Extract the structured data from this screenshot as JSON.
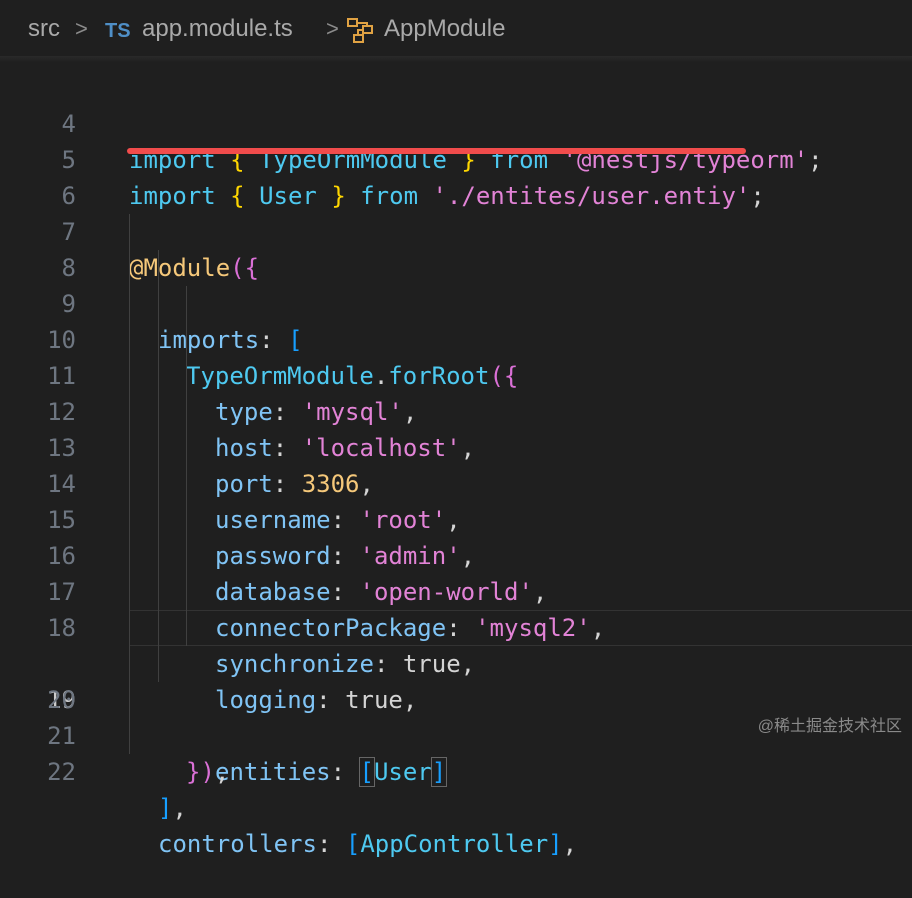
{
  "breadcrumb": {
    "folder": "src",
    "sep1": ">",
    "lang_badge": "TS",
    "file": "app.module.ts",
    "sep2": ">",
    "symbol": "AppModule"
  },
  "editor": {
    "active_line": "19",
    "lines": [
      {
        "num": "4"
      },
      {
        "num": "5"
      },
      {
        "num": "6"
      },
      {
        "num": "7"
      },
      {
        "num": "8"
      },
      {
        "num": "9"
      },
      {
        "num": "10"
      },
      {
        "num": "11"
      },
      {
        "num": "12"
      },
      {
        "num": "13"
      },
      {
        "num": "14"
      },
      {
        "num": "15"
      },
      {
        "num": "16"
      },
      {
        "num": "17"
      },
      {
        "num": "18"
      },
      {
        "num": "19"
      },
      {
        "num": "20"
      },
      {
        "num": "21"
      },
      {
        "num": "22"
      }
    ],
    "tokens": {
      "l4": [
        "import",
        "{",
        "TypeOrmModule",
        "}",
        "from",
        "'@nestjs/typeorm'",
        ";"
      ],
      "l5": [
        "import",
        "{",
        "User",
        "}",
        "from",
        "'./entites/user.entiy'",
        ";"
      ],
      "l7": [
        "@Module",
        "(",
        "{"
      ],
      "l8": [
        "imports",
        ":",
        "["
      ],
      "l9": [
        "TypeOrmModule",
        ".",
        "forRoot",
        "(",
        "{"
      ],
      "l10": [
        "type",
        ":",
        "'mysql'",
        ","
      ],
      "l11": [
        "host",
        ":",
        "'localhost'",
        ","
      ],
      "l12": [
        "port",
        ":",
        "3306",
        ","
      ],
      "l13": [
        "username",
        ":",
        "'root'",
        ","
      ],
      "l14": [
        "password",
        ":",
        "'admin'",
        ","
      ],
      "l15": [
        "database",
        ":",
        "'open-world'",
        ","
      ],
      "l16": [
        "connectorPackage",
        ":",
        "'mysql2'",
        ","
      ],
      "l17": [
        "synchronize",
        ":",
        "true",
        ","
      ],
      "l18": [
        "logging",
        ":",
        "true",
        ","
      ],
      "l19": [
        "entities",
        ":",
        "[",
        "User",
        "]"
      ],
      "l20": [
        "}",
        ")",
        ","
      ],
      "l21": [
        "]",
        ","
      ],
      "l22": [
        "controllers",
        ":",
        "[",
        "AppController",
        "]",
        ","
      ]
    }
  },
  "watermark": "@稀土掘金技术社区",
  "colors": {
    "background": "#1f1f1f",
    "highlight_underline": "#f14c4c",
    "string": "#e283d6",
    "identifier": "#4ec9f0"
  },
  "icons": [
    "symbol-module-icon"
  ]
}
